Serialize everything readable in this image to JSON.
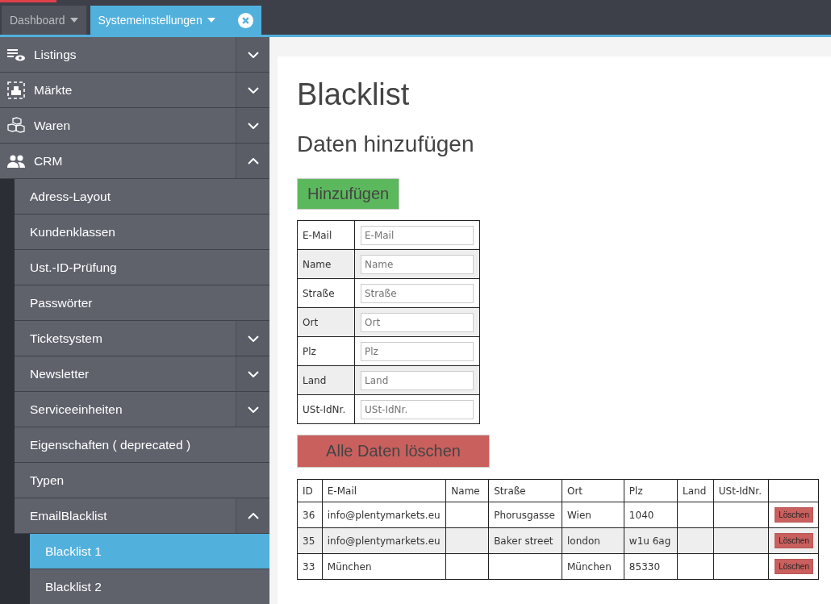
{
  "tabs": [
    {
      "label": "Dashboard",
      "selected": false,
      "closable": false
    },
    {
      "label": "Systemeinstellungen",
      "selected": true,
      "closable": true
    }
  ],
  "sidebar": {
    "items": [
      {
        "label": "Listings",
        "kind": "listings",
        "expanded": false,
        "selected": false
      },
      {
        "label": "Märkte",
        "kind": "markets",
        "expanded": false,
        "selected": false
      },
      {
        "label": "Waren",
        "kind": "goods",
        "expanded": false,
        "selected": false
      },
      {
        "label": "CRM",
        "kind": "crm",
        "expanded": true,
        "selected": false,
        "children": [
          {
            "label": "Adress-Layout",
            "selected": false
          },
          {
            "label": "Kundenklassen",
            "selected": false
          },
          {
            "label": "Ust.-ID-Prüfung",
            "selected": false
          },
          {
            "label": "Passwörter",
            "selected": false
          },
          {
            "label": "Ticketsystem",
            "expanded": false,
            "selected": false
          },
          {
            "label": "Newsletter",
            "expanded": false,
            "selected": false
          },
          {
            "label": "Serviceeinheiten",
            "expanded": false,
            "selected": false
          },
          {
            "label": "Eigenschaften ( deprecated )",
            "selected": false
          },
          {
            "label": "Typen",
            "selected": false
          },
          {
            "label": "EmailBlacklist",
            "expanded": true,
            "selected": false,
            "children": [
              {
                "label": "Blacklist 1",
                "selected": true
              },
              {
                "label": "Blacklist 2",
                "selected": false
              }
            ]
          }
        ]
      }
    ]
  },
  "page": {
    "title": "Blacklist",
    "subtitle": "Daten hinzufügen",
    "add_button": "Hinzufügen",
    "form": [
      {
        "label": "E-Mail",
        "placeholder": "E-Mail"
      },
      {
        "label": "Name",
        "placeholder": "Name"
      },
      {
        "label": "Straße",
        "placeholder": "Straße"
      },
      {
        "label": "Ort",
        "placeholder": "Ort"
      },
      {
        "label": "Plz",
        "placeholder": "Plz"
      },
      {
        "label": "Land",
        "placeholder": "Land"
      },
      {
        "label": "USt-IdNr.",
        "placeholder": "USt-IdNr."
      }
    ],
    "delete_all_button": "Alle Daten löschen",
    "table": {
      "columns": [
        "ID",
        "E-Mail",
        "Name",
        "Straße",
        "Ort",
        "Plz",
        "Land",
        "USt-IdNr."
      ],
      "rows": [
        {
          "cells": [
            "36",
            "info@plentymarkets.eu",
            "",
            "Phorusgasse",
            "Wien",
            "1040",
            "",
            ""
          ],
          "action": "Löschen"
        },
        {
          "cells": [
            "35",
            "info@plentymarkets.eu",
            "",
            "Baker street",
            "london",
            "w1u 6ag",
            "",
            ""
          ],
          "action": "Löschen"
        },
        {
          "cells": [
            "33",
            "München",
            "",
            "",
            "München",
            "85330",
            "",
            ""
          ],
          "action": "Löschen"
        }
      ]
    }
  }
}
